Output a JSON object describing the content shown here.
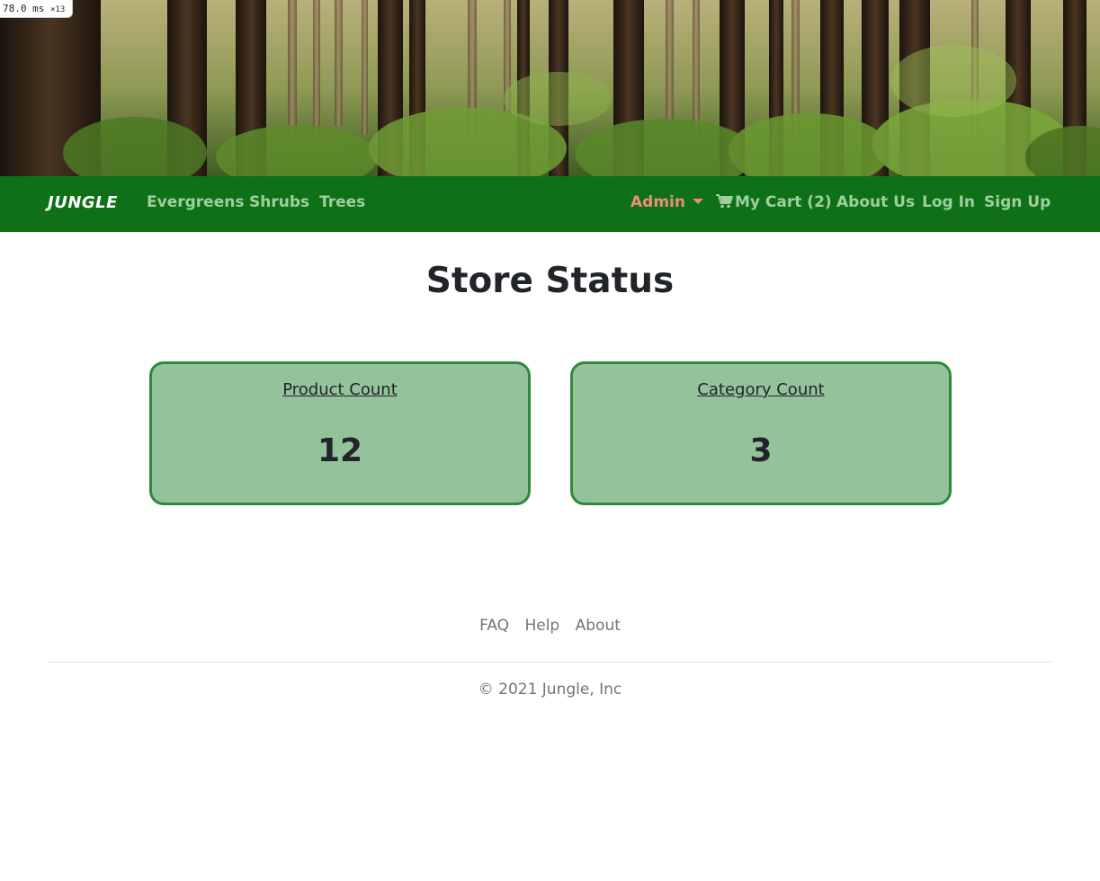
{
  "perf_badge": {
    "time": "78.0",
    "unit": "ms",
    "multiplier": "×13"
  },
  "navbar": {
    "brand": "JUNGLE",
    "left_links": [
      "Evergreens",
      "Shrubs",
      "Trees"
    ],
    "admin_label": "Admin",
    "cart_label": "My Cart (2)",
    "right_links": [
      "About Us",
      "Log In",
      "Sign Up"
    ]
  },
  "main": {
    "title": "Store Status",
    "cards": [
      {
        "label": "Product Count",
        "value": "12"
      },
      {
        "label": "Category Count",
        "value": "3"
      }
    ]
  },
  "footer": {
    "links": [
      "FAQ",
      "Help",
      "About"
    ],
    "copyright": "© 2021 Jungle, Inc"
  },
  "colors": {
    "navbar_bg": "#0e7118",
    "nav_link": "#9fcf9f",
    "admin_accent": "#f08a7a",
    "card_bg": "#93c29b",
    "card_border": "#2f8a3c"
  },
  "icons": {
    "cart": "shopping-cart-icon",
    "admin_dropdown": "caret-down-icon"
  }
}
